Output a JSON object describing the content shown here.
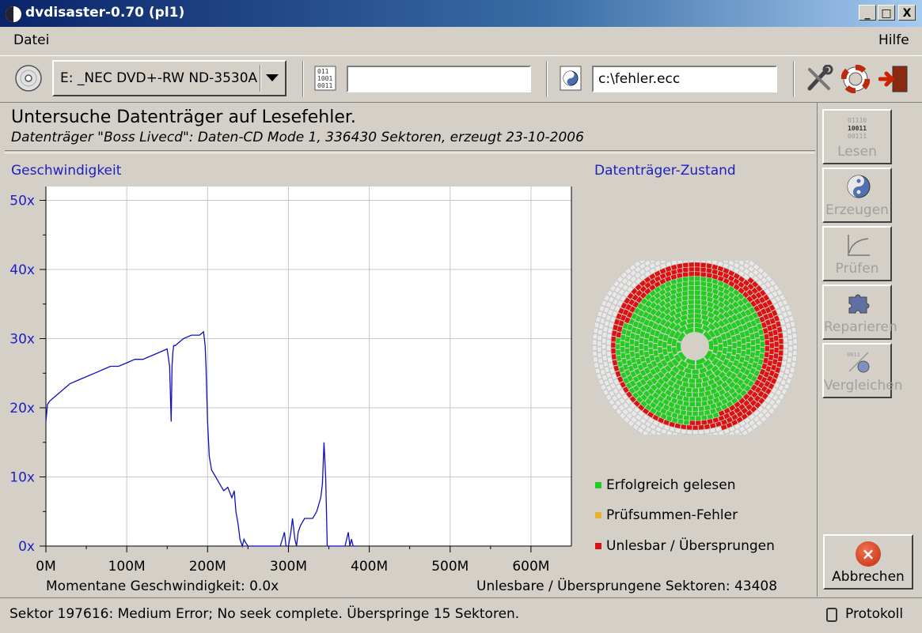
{
  "window": {
    "title": "dvdisaster-0.70 (pl1)",
    "minimize": "_",
    "maximize": "□",
    "close": "X"
  },
  "menu": {
    "file": "Datei",
    "help": "Hilfe"
  },
  "toolbar": {
    "drive": "E:  _NEC DVD+-RW ND-3530A",
    "image_file": "",
    "ecc_file": "c:\\fehler.ecc"
  },
  "header": {
    "title": "Untersuche Datenträger auf Lesefehler.",
    "subtitle": "Datenträger \"Boss Livecd\": Daten-CD Mode 1, 336430 Sektoren, erzeugt 23-10-2006"
  },
  "speed_panel": {
    "label": "Geschwindigkeit",
    "current_speed": "Momentane Geschwindigkeit: 0.0x"
  },
  "chart_data": {
    "type": "line",
    "title": "Geschwindigkeit",
    "xlabel": "",
    "ylabel": "",
    "x_ticks": [
      "0M",
      "100M",
      "200M",
      "300M",
      "400M",
      "500M",
      "600M"
    ],
    "y_ticks": [
      "0x",
      "10x",
      "20x",
      "30x",
      "40x",
      "50x"
    ],
    "xlim": [
      0,
      650
    ],
    "ylim": [
      0,
      52
    ],
    "grid": true,
    "series": [
      {
        "x": [
          0,
          2,
          5,
          10,
          20,
          30,
          40,
          50,
          60,
          70,
          80,
          90,
          100,
          110,
          120,
          130,
          140,
          150,
          153,
          154,
          155,
          156,
          157,
          158,
          160,
          170,
          180,
          190,
          195,
          196,
          197,
          198,
          199,
          200,
          202,
          205,
          210,
          215,
          220,
          225,
          230,
          233,
          235,
          238,
          240,
          243,
          245,
          247,
          250,
          255,
          290,
          295,
          297,
          300,
          303,
          305,
          308,
          310,
          312,
          315,
          320,
          325,
          330,
          335,
          340,
          342,
          344,
          346,
          348,
          350,
          360,
          370,
          372,
          374,
          376,
          378,
          380,
          385
        ],
        "y": [
          18,
          20.5,
          21,
          21.5,
          22.5,
          23.5,
          24,
          24.5,
          25,
          25.5,
          26,
          26,
          26.5,
          27,
          27,
          27.5,
          28,
          28.5,
          26,
          22,
          18,
          26,
          28,
          29,
          29,
          30,
          30.5,
          30.5,
          31,
          30,
          29,
          26,
          22,
          18,
          13,
          11,
          10,
          9,
          8,
          8.5,
          7,
          8,
          5,
          3,
          1,
          0,
          1,
          0.5,
          0,
          0,
          0,
          2,
          0,
          0,
          2,
          4,
          1,
          0,
          2,
          3,
          4,
          4,
          4,
          5,
          7,
          9,
          15,
          10,
          0,
          0,
          0,
          0,
          1,
          2,
          0,
          1,
          0,
          0
        ]
      }
    ]
  },
  "disc_panel": {
    "label": "Datenträger-Zustand",
    "colors": {
      "read_ok": "#22cc22",
      "checksum_error": "#e8b030",
      "unreadable": "#dd1111",
      "unvisited": "#e8e8e8"
    }
  },
  "legend": {
    "read_ok": "Erfolgreich gelesen",
    "checksum_error": "Prüfsummen-Fehler",
    "unreadable": "Unlesbar / Übersprungen"
  },
  "unreadable_count": "Unlesbare / Übersprungene Sektoren: 43408",
  "sidebar": {
    "read": "Lesen",
    "create": "Erzeugen",
    "verify": "Prüfen",
    "repair": "Reparieren",
    "compare": "Vergleichen",
    "abort": "Abbrechen"
  },
  "status": {
    "message": "Sektor 197616: Medium Error; No seek complete. Überspringe 15 Sektoren.",
    "log": "Protokoll"
  }
}
